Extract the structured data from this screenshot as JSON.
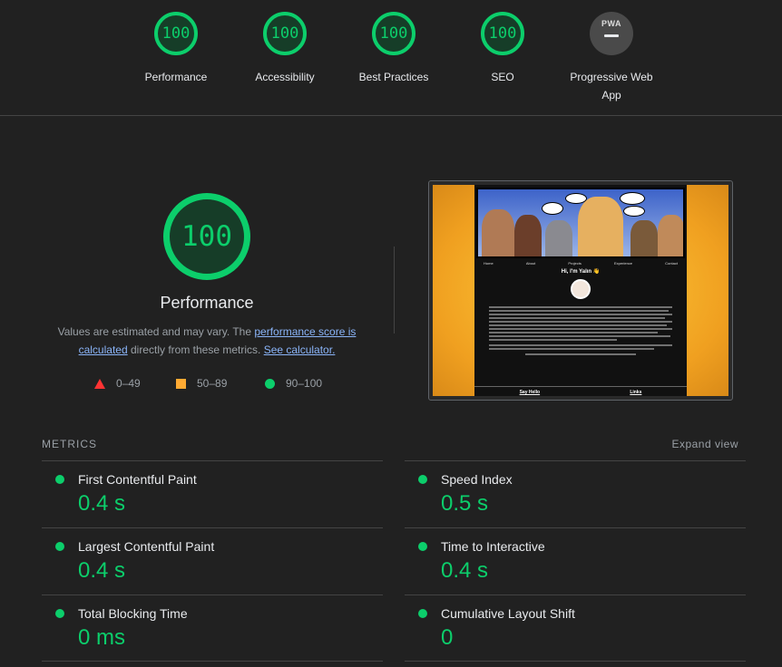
{
  "top_scores": [
    {
      "score": "100",
      "label": "Performance"
    },
    {
      "score": "100",
      "label": "Accessibility"
    },
    {
      "score": "100",
      "label": "Best Practices"
    },
    {
      "score": "100",
      "label": "SEO"
    }
  ],
  "pwa": {
    "icon_text": "PWA",
    "label_line1": "Progressive Web",
    "label_line2": "App"
  },
  "performance": {
    "score": "100",
    "title": "Performance",
    "desc_prefix": "Values are estimated and may vary. The ",
    "desc_link1": "performance score is calculated",
    "desc_middle": " directly from these metrics. ",
    "desc_link2": "See calculator."
  },
  "legend": [
    {
      "range": "0–49",
      "icon": "triangle-fail-icon"
    },
    {
      "range": "50–89",
      "icon": "square-average-icon"
    },
    {
      "range": "90–100",
      "icon": "circle-pass-icon"
    }
  ],
  "screenshot": {
    "nav": [
      "Home",
      "About",
      "Projects",
      "Experience",
      "Contact"
    ],
    "greeting": "Hi, I'm Yalın 👋",
    "bottom_links": [
      "Say Hello",
      "Links"
    ]
  },
  "metrics": {
    "title": "METRICS",
    "expand_label": "Expand view",
    "items": [
      {
        "name": "First Contentful Paint",
        "value": "0.4 s"
      },
      {
        "name": "Speed Index",
        "value": "0.5 s"
      },
      {
        "name": "Largest Contentful Paint",
        "value": "0.4 s"
      },
      {
        "name": "Time to Interactive",
        "value": "0.4 s"
      },
      {
        "name": "Total Blocking Time",
        "value": "0 ms"
      },
      {
        "name": "Cumulative Layout Shift",
        "value": "0"
      }
    ]
  },
  "colors": {
    "pass": "#0cce6b",
    "average": "#ffaa33",
    "fail": "#ff3333",
    "background": "#212121"
  }
}
